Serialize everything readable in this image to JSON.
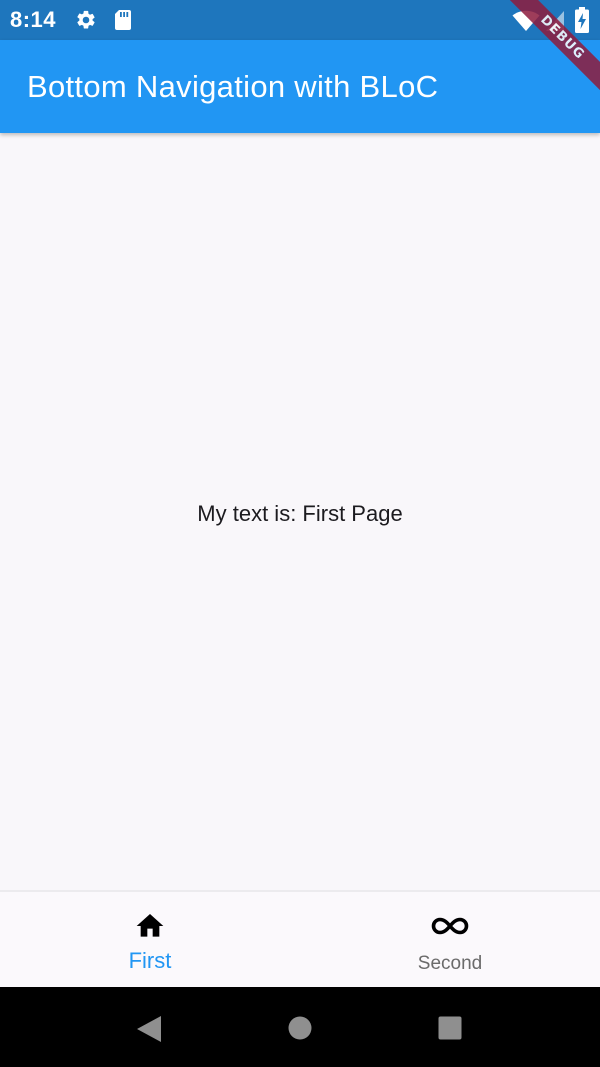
{
  "status_bar": {
    "time": "8:14",
    "icons": [
      "gear-icon",
      "sd-card-icon",
      "wifi-icon",
      "signal-icon",
      "battery-charging-icon"
    ],
    "background": "#1e76bd"
  },
  "debug_banner": {
    "label": "DEBUG"
  },
  "app_bar": {
    "title": "Bottom Navigation with BLoC",
    "background": "#2196f3"
  },
  "main": {
    "text": "My text is: First Page"
  },
  "bottom_nav": {
    "selected_index": 0,
    "selected_color": "#2196f3",
    "unselected_color": "#6b6b6b",
    "items": [
      {
        "label": "First",
        "icon": "home-icon"
      },
      {
        "label": "Second",
        "icon": "infinity-icon"
      }
    ]
  },
  "system_nav": {
    "buttons": [
      "back-icon",
      "home-circle-icon",
      "recents-square-icon"
    ]
  }
}
